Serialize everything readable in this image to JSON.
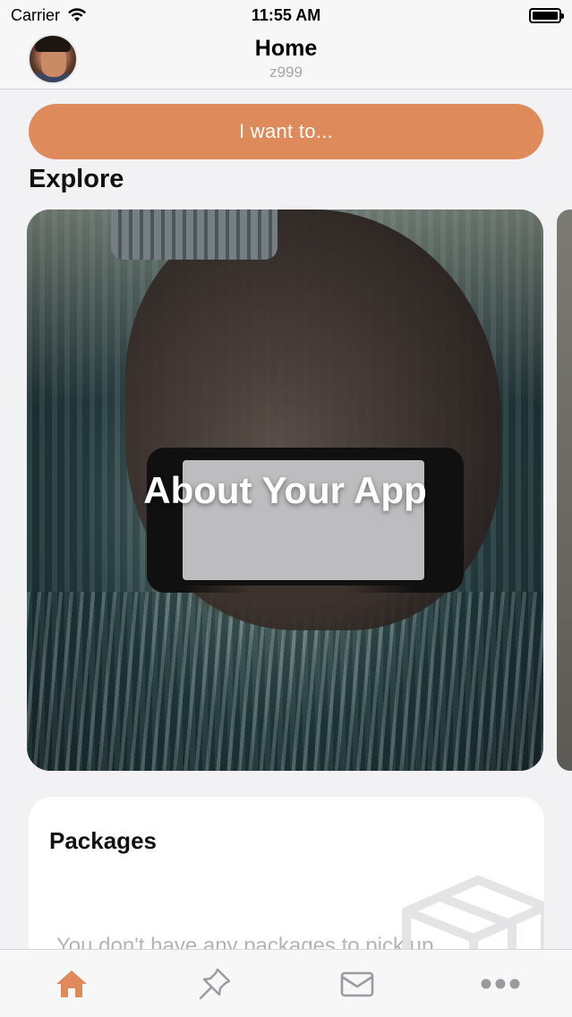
{
  "status_bar": {
    "carrier": "Carrier",
    "time": "11:55 AM",
    "wifi_icon": "wifi-icon",
    "battery_icon": "battery-icon"
  },
  "header": {
    "title": "Home",
    "subtitle": "z999",
    "avatar_icon": "user-avatar"
  },
  "actions": {
    "want_to_label": "I want to...",
    "accent_color": "#df8a5a"
  },
  "explore": {
    "section_title": "Explore",
    "cards": [
      {
        "title": "About Your App"
      }
    ]
  },
  "packages": {
    "title": "Packages",
    "empty_text": "You don't have any packages to pick up",
    "icon": "package-box-icon"
  },
  "tab_bar": {
    "tabs": [
      {
        "icon": "home-icon",
        "active": true
      },
      {
        "icon": "pin-icon",
        "active": false
      },
      {
        "icon": "mail-icon",
        "active": false
      },
      {
        "icon": "more-icon",
        "active": false
      }
    ],
    "active_color": "#df8a5a",
    "inactive_color": "#9a9aa0"
  }
}
